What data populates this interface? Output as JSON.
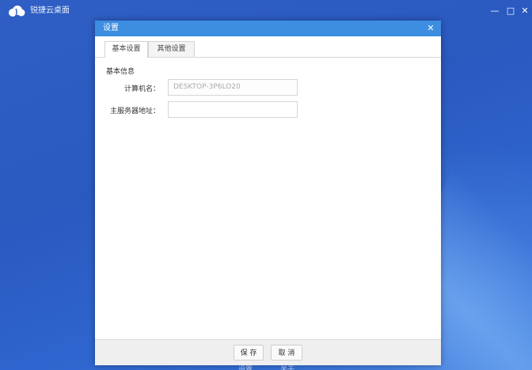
{
  "app": {
    "title": "锐捷云桌面",
    "logo_icon": "cloud-logo-icon",
    "window_controls": {
      "minimize": "—",
      "maximize": "□",
      "close": "✕"
    }
  },
  "dialog": {
    "title": "设置",
    "close_glyph": "✕",
    "tabs": [
      {
        "label": "基本设置",
        "active": true
      },
      {
        "label": "其他设置",
        "active": false
      }
    ],
    "section_title": "基本信息",
    "fields": {
      "computer_name": {
        "label": "计算机名：",
        "value": "DESKTOP-3P6LO20"
      },
      "server_address": {
        "label": "主服务器地址：",
        "value": ""
      }
    },
    "buttons": {
      "save": "保 存",
      "cancel": "取 消"
    }
  },
  "under_labels": {
    "settings": "设置",
    "about": "关于"
  },
  "colors": {
    "dialog_header": "#3d8de0",
    "desktop": "#2a59c0"
  }
}
